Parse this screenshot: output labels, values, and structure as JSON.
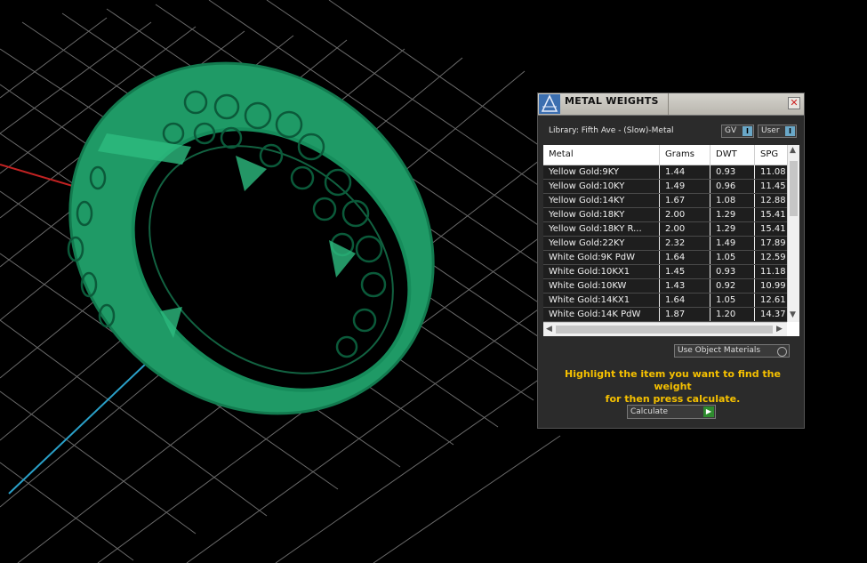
{
  "panel": {
    "title": "METAL WEIGHTS",
    "close_symbol": "✕",
    "library_label": "Library: Fifth Ave - (Slow)-Metal",
    "toggles": [
      {
        "label": "GV",
        "indicator": "I"
      },
      {
        "label": "User",
        "indicator": "I"
      }
    ],
    "columns": [
      "Metal",
      "Grams",
      "DWT",
      "SPG"
    ],
    "rows": [
      {
        "metal": "Yellow Gold:9KY",
        "grams": "1.44",
        "dwt": "0.93",
        "spg": "11.08"
      },
      {
        "metal": "Yellow Gold:10KY",
        "grams": "1.49",
        "dwt": "0.96",
        "spg": "11.45"
      },
      {
        "metal": "Yellow Gold:14KY",
        "grams": "1.67",
        "dwt": "1.08",
        "spg": "12.88"
      },
      {
        "metal": "Yellow Gold:18KY",
        "grams": "2.00",
        "dwt": "1.29",
        "spg": "15.41"
      },
      {
        "metal": "Yellow Gold:18KY R...",
        "grams": "2.00",
        "dwt": "1.29",
        "spg": "15.41"
      },
      {
        "metal": "Yellow Gold:22KY",
        "grams": "2.32",
        "dwt": "1.49",
        "spg": "17.89"
      },
      {
        "metal": "White Gold:9K PdW",
        "grams": "1.64",
        "dwt": "1.05",
        "spg": "12.59"
      },
      {
        "metal": "White Gold:10KX1",
        "grams": "1.45",
        "dwt": "0.93",
        "spg": "11.18"
      },
      {
        "metal": "White Gold:10KW",
        "grams": "1.43",
        "dwt": "0.92",
        "spg": "10.99"
      },
      {
        "metal": "White Gold:14KX1",
        "grams": "1.64",
        "dwt": "1.05",
        "spg": "12.61"
      },
      {
        "metal": "White Gold:14K PdW",
        "grams": "1.87",
        "dwt": "1.20",
        "spg": "14.37"
      }
    ],
    "use_object_materials": "Use Object Materials",
    "hint_line1": "Highlight the item you want to find the weight",
    "hint_line2": "for then press calculate.",
    "calculate_label": "Calculate",
    "calculate_icon": "▶"
  },
  "colors": {
    "model_green": "#1f9a66",
    "grid": "#6a6a6a",
    "x_axis": "#c22222",
    "y_axis": "#2aa0c8",
    "hint": "#f5c000"
  },
  "icons": {
    "logo": "gemvision-logo-icon",
    "close": "close-icon",
    "scroll_up": "chevron-up-icon",
    "scroll_down": "chevron-down-icon",
    "scroll_left": "chevron-left-icon",
    "scroll_right": "chevron-right-icon",
    "calculate": "play-icon"
  }
}
